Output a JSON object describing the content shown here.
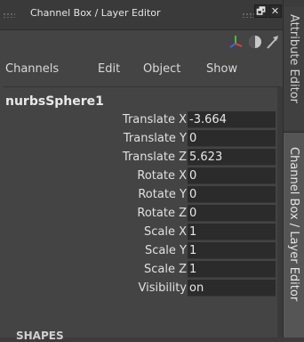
{
  "window": {
    "title": "Channel Box / Layer Editor",
    "float_label": "🗗",
    "close_label": "✕"
  },
  "menu": {
    "channels": "Channels",
    "edit": "Edit",
    "object": "Object",
    "show": "Show"
  },
  "toolbar_icons": [
    "axis-tool-icon",
    "half-circle-icon",
    "arrow-icon"
  ],
  "node": {
    "name": "nurbsSphere1"
  },
  "attributes": [
    {
      "label": "Translate X",
      "value": "-3.664"
    },
    {
      "label": "Translate Y",
      "value": "0"
    },
    {
      "label": "Translate Z",
      "value": "5.623"
    },
    {
      "label": "Rotate X",
      "value": "0"
    },
    {
      "label": "Rotate Y",
      "value": "0"
    },
    {
      "label": "Rotate Z",
      "value": "0"
    },
    {
      "label": "Scale X",
      "value": "1"
    },
    {
      "label": "Scale Y",
      "value": "1"
    },
    {
      "label": "Scale Z",
      "value": "1"
    },
    {
      "label": "Visibility",
      "value": "on"
    }
  ],
  "shapes_header": "SHAPES",
  "side_tabs": {
    "attribute_editor": "Attribute Editor",
    "channel_box": "Channel Box / Layer Editor"
  },
  "colors": {
    "panel_bg": "#444444",
    "field_bg": "#2b2b2b",
    "axis_x": "#e04040",
    "axis_y": "#40c040",
    "axis_z": "#4060e0"
  }
}
